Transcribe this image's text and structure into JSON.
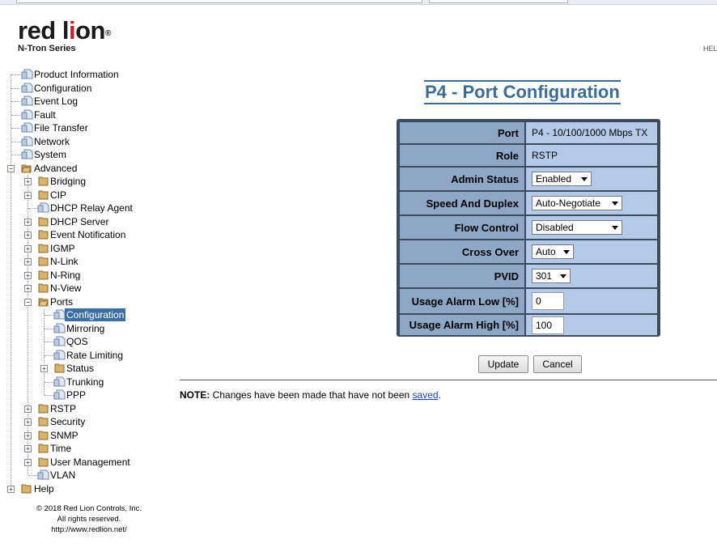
{
  "brand": {
    "name_part1": "red l",
    "name_dot": "i",
    "name_part2": "on",
    "reg": "®",
    "series": "N-Tron Series"
  },
  "header_right": "HEL",
  "tree": {
    "items": [
      "Product Information",
      "Configuration",
      "Event Log",
      "Fault",
      "File Transfer",
      "Network",
      "System",
      "Advanced",
      "Bridging",
      "CIP",
      "DHCP Relay Agent",
      "DHCP Server",
      "Event Notification",
      "IGMP",
      "N-Link",
      "N-Ring",
      "N-View",
      "Ports",
      "Configuration",
      "Mirroring",
      "QOS",
      "Rate Limiting",
      "Status",
      "Trunking",
      "PPP",
      "RSTP",
      "Security",
      "SNMP",
      "Time",
      "User Management",
      "VLAN",
      "Help"
    ],
    "expanded_sign": "−",
    "collapsed_sign": "+"
  },
  "footer": {
    "copyright": "© 2018 Red Lion Controls, Inc.",
    "rights": "All rights reserved.",
    "url": "http://www.redlion.net/"
  },
  "page": {
    "title": "P4 - Port Configuration"
  },
  "form": {
    "port": {
      "label": "Port",
      "value": "P4 - 10/100/1000 Mbps TX"
    },
    "role": {
      "label": "Role",
      "value": "RSTP"
    },
    "admin_status": {
      "label": "Admin Status",
      "value": "Enabled"
    },
    "speed_duplex": {
      "label": "Speed And Duplex",
      "value": "Auto-Negotiate"
    },
    "flow_control": {
      "label": "Flow Control",
      "value": "Disabled"
    },
    "cross_over": {
      "label": "Cross Over",
      "value": "Auto"
    },
    "pvid": {
      "label": "PVID",
      "value": "301"
    },
    "alarm_low": {
      "label": "Usage Alarm Low [%]",
      "value": "0"
    },
    "alarm_high": {
      "label": "Usage Alarm High [%]",
      "value": "100"
    }
  },
  "buttons": {
    "update": "Update",
    "cancel": "Cancel"
  },
  "note": {
    "prefix": "NOTE:",
    "text": " Changes have been made that have not been ",
    "link": "saved",
    "suffix": "."
  },
  "colors": {
    "accent": "#3a6b9c",
    "label_bg": "#8ea7c7",
    "value_bg": "#b3cbe8",
    "panel_border": "#3c4b5f",
    "selected_bg": "#3a6ea5"
  }
}
